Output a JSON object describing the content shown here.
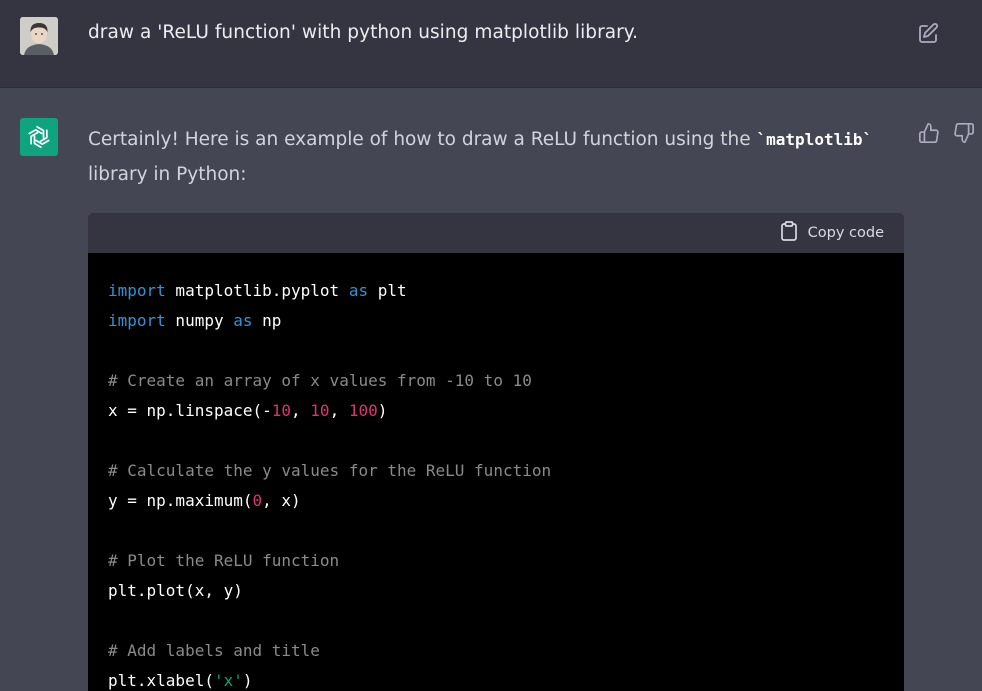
{
  "user_message": {
    "text": "draw a 'ReLU function' with python using matplotlib library."
  },
  "assistant_message": {
    "intro_before": "Certainly! Here is an example of how to draw a ReLU function using the ",
    "inline_code": "`matplotlib`",
    "intro_after": " library in Python:"
  },
  "code_block": {
    "copy_label": "Copy code",
    "lines": {
      "l1_kw": "import",
      "l1_a": " matplotlib.pyplot ",
      "l1_kw2": "as",
      "l1_b": " plt",
      "l2_kw": "import",
      "l2_a": " numpy ",
      "l2_kw2": "as",
      "l2_b": " np",
      "l4_cm": "# Create an array of x values from -10 to 10",
      "l5_a": "x = np.linspace(-",
      "l5_n1": "10",
      "l5_b": ", ",
      "l5_n2": "10",
      "l5_c": ", ",
      "l5_n3": "100",
      "l5_d": ")",
      "l7_cm": "# Calculate the y values for the ReLU function",
      "l8_a": "y = np.maximum(",
      "l8_n1": "0",
      "l8_b": ", x)",
      "l10_cm": "# Plot the ReLU function",
      "l11_a": "plt.plot(x, y)",
      "l13_cm": "# Add labels and title",
      "l14_a": "plt.xlabel(",
      "l14_s": "'x'",
      "l14_b": ")"
    }
  },
  "colors": {
    "keyword": "#2e95d3",
    "comment": "#8a8a8a",
    "number": "#df3079",
    "string": "#00a67d",
    "brand": "#10a37f"
  },
  "icons": [
    "user-avatar",
    "edit-icon",
    "openai-logo-icon",
    "thumbs-up-icon",
    "thumbs-down-icon",
    "clipboard-icon"
  ]
}
